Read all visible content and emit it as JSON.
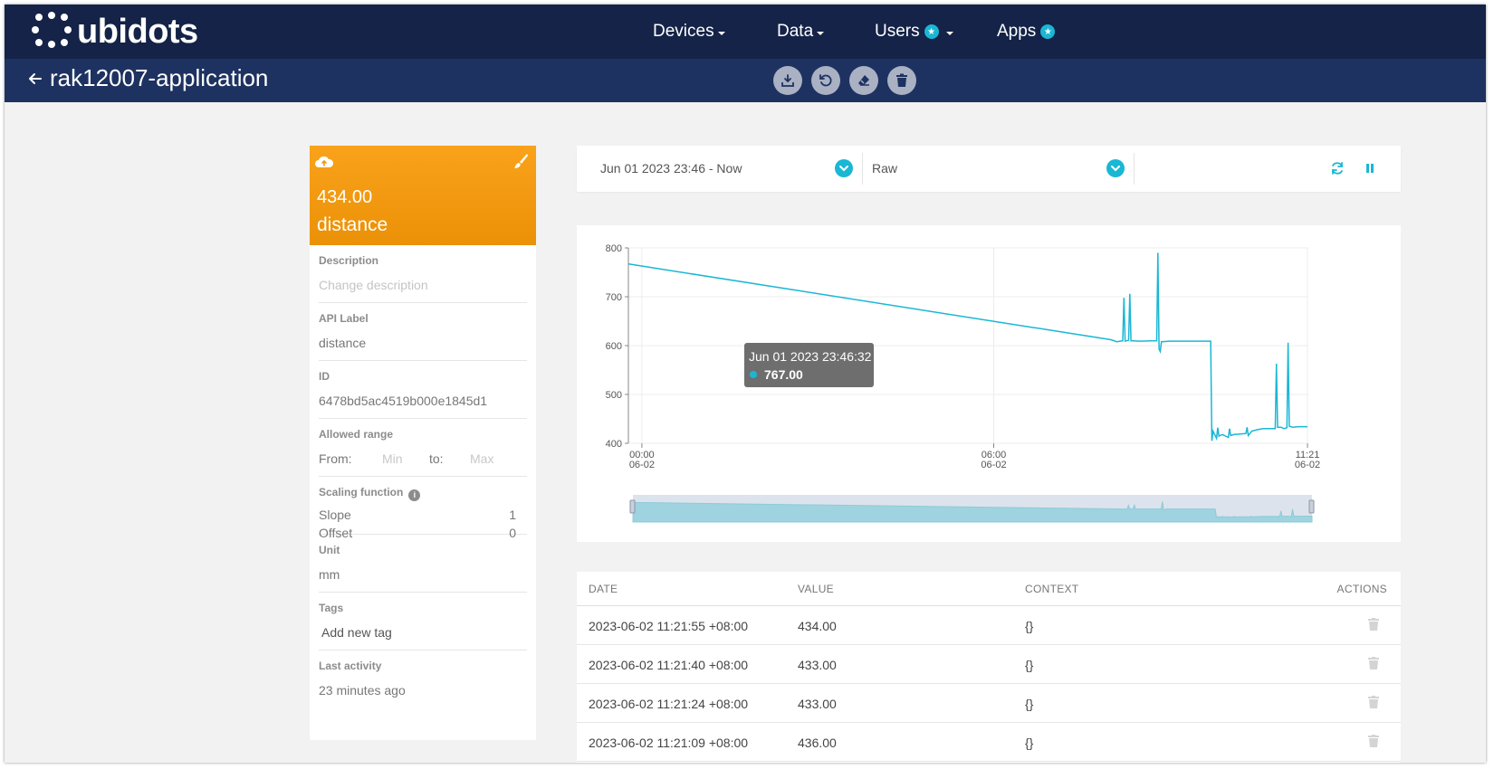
{
  "brand": {
    "name": "ubidots"
  },
  "nav": {
    "devices": "Devices",
    "data": "Data",
    "users": "Users",
    "apps": "Apps",
    "star_badge_icon": "star-icon",
    "badge_color": "#1ab7d4"
  },
  "subbar": {
    "title": "rak12007-application",
    "tools": [
      "download-icon",
      "history-icon",
      "eraser-icon",
      "trash-icon"
    ]
  },
  "variable": {
    "last_value": "434.00",
    "name": "distance",
    "header_color": "#f9a21a",
    "description_label": "Description",
    "description_placeholder": "Change description",
    "api_label_label": "API Label",
    "api_label": "distance",
    "id_label": "ID",
    "id": "6478bd5ac4519b000e1845d1",
    "allowed_range_label": "Allowed range",
    "from_label": "From:",
    "min_placeholder": "Min",
    "to_label": "to:",
    "max_placeholder": "Max",
    "scaling_label": "Scaling function",
    "slope_label": "Slope",
    "slope": "1",
    "offset_label": "Offset",
    "offset": "0",
    "unit_label": "Unit",
    "unit": "mm",
    "tags_label": "Tags",
    "add_tag": "Add new tag",
    "last_activity_label": "Last activity",
    "last_activity": "23 minutes ago"
  },
  "filter": {
    "date_range": "Jun 01 2023 23:46 - Now",
    "aggregation": "Raw"
  },
  "chart_data": {
    "type": "line",
    "color": "#1ab7d4",
    "title": "",
    "xlabel": "",
    "ylabel": "",
    "ylim": [
      400,
      800
    ],
    "yticks": [
      "400",
      "500",
      "600",
      "700",
      "800"
    ],
    "xticks": [
      {
        "hour": 0,
        "time": "00:00",
        "date": "06-02"
      },
      {
        "hour": 6,
        "time": "06:00",
        "date": "06-02"
      },
      {
        "hour": 11.35,
        "time": "11:21",
        "date": "06-02"
      }
    ],
    "xlim_hours": [
      -0.23,
      11.35
    ],
    "grid": true,
    "series": [
      {
        "x_hours": [
          -0.225,
          8.0,
          8.1,
          8.2,
          8.22,
          8.24,
          8.3,
          8.32,
          8.34,
          8.5,
          8.78,
          8.8,
          8.82,
          8.84,
          8.86,
          9.0,
          9.5,
          9.7,
          9.72,
          9.74,
          9.8,
          9.82,
          9.84,
          9.9,
          10.0,
          10.02,
          10.04,
          10.1,
          10.3,
          10.32,
          10.34,
          10.4,
          10.5,
          10.6,
          10.8,
          10.82,
          10.84,
          10.9,
          10.95,
          11.0,
          11.02,
          11.04,
          11.1,
          11.2,
          11.35
        ],
        "values": [
          767,
          612,
          608,
          610,
          698,
          609,
          611,
          706,
          610,
          609,
          610,
          790,
          593,
          588,
          608,
          609,
          609,
          609,
          405,
          425,
          410,
          432,
          415,
          418,
          412,
          430,
          416,
          418,
          420,
          433,
          416,
          425,
          428,
          430,
          430,
          563,
          433,
          433,
          430,
          432,
          606,
          435,
          433,
          434,
          434
        ]
      }
    ],
    "tooltip": {
      "title": "Jun 01 2023 23:46:32",
      "value": "767.00"
    }
  },
  "table": {
    "headers": {
      "date": "DATE",
      "value": "VALUE",
      "context": "CONTEXT",
      "actions": "ACTIONS"
    },
    "rows": [
      {
        "date": "2023-06-02 11:21:55 +08:00",
        "value": "434.00",
        "context": "{}"
      },
      {
        "date": "2023-06-02 11:21:40 +08:00",
        "value": "433.00",
        "context": "{}"
      },
      {
        "date": "2023-06-02 11:21:24 +08:00",
        "value": "433.00",
        "context": "{}"
      },
      {
        "date": "2023-06-02 11:21:09 +08:00",
        "value": "436.00",
        "context": "{}"
      }
    ]
  }
}
